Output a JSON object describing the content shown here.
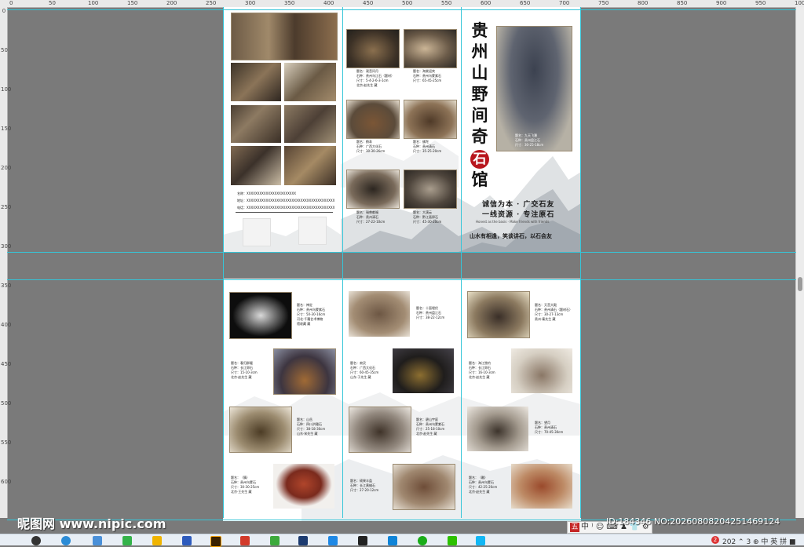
{
  "rulers": {
    "top_ticks": [
      "0",
      "50",
      "100",
      "150",
      "200",
      "250",
      "300",
      "350",
      "400",
      "450",
      "500",
      "550",
      "600",
      "650",
      "700",
      "750",
      "800",
      "850",
      "900",
      "950",
      "1000"
    ],
    "left_ticks": [
      "0",
      "50",
      "100",
      "150",
      "200",
      "250",
      "300",
      "350",
      "400",
      "450",
      "500",
      "550",
      "600"
    ]
  },
  "brochure": {
    "title_chars": [
      "贵",
      "州",
      "山",
      "野",
      "间",
      "奇"
    ],
    "title_red_chars": [
      "石",
      "馆"
    ],
    "slogan_lines": [
      "诚信为本 · 广交石友",
      "一线资源 · 专注原石"
    ],
    "slogan_en": "Honest as the basis · Make friends with friends",
    "slogan_bottom": "山水有相逢，笑谈讲石，以石会友",
    "cover_caption": [
      "题名：九天飞瀑",
      "石种：贵州盘江石",
      "尺寸：30-25-18cm"
    ],
    "contact": [
      {
        "label": "名称：",
        "value": "XXXXXXXXXXXXXXXXXXXXXXX"
      },
      {
        "label": "地址：",
        "value": "XXXXXXXXXXXXXXXXXXXXXXXXXXXXXXXXXXXXXXXXX"
      },
      {
        "label": "电话：",
        "value": "XXXXXXXXXXXXXXXXXXXXXXXXXXXXXXXXXXXXXXXXX"
      }
    ],
    "page1_middle_captions": [
      [
        "题名：观音问月",
        "石种：贵州乌江石（题材）",
        "尺寸：5-4-2-6-3-1cm",
        "北京·赵先生 藏"
      ],
      [
        "题名：海棠迎宾",
        "石种：贵州乌蒙紫石",
        "尺寸：65-45-25cm"
      ],
      [
        "题名：鹤寿",
        "石种：广西大化石",
        "尺寸：30-30-26cm"
      ],
      [
        "题名：佛陀",
        "石种：贵州清石",
        "尺寸：35-25-20cm"
      ],
      [
        "题名：瑞兽献福",
        "石种：贵州清石",
        "尺寸：27-22-10cm"
      ],
      [
        "题名：大漠云",
        "石种：黔江画卵石",
        "尺寸：45-30-20cm"
      ]
    ],
    "page2_captions": [
      [
        "题名：禅定",
        "石种：贵州乌蒙紫石",
        "尺寸：50-30-16cm",
        "河北·千羅艺术博物",
        "馆收藏 藏"
      ],
      [
        "题名：十面埋伏",
        "石种：贵州盘江石",
        "尺寸：38-22-12cm"
      ],
      [
        "题名：天音大殿",
        "石种：贵州清石（题材石）",
        "尺寸：30-27-13cm",
        "贵州·秦先生 藏"
      ],
      [
        "题名：春归群暖",
        "石种：长江卵石",
        "尺寸：15-10-3cm",
        "北京·赵先生 藏"
      ],
      [
        "题名：寂灵",
        "石种：广西大化石",
        "尺寸：60-45-35cm",
        "山东·于先生 藏"
      ],
      [
        "题名：海江独钓",
        "石种：长江卵石",
        "尺寸：16-10-3cm",
        "北京·赵先生 藏"
      ],
      [
        "题名：山岳",
        "石种：四川洪雅石",
        "尺寸：38-18-30cm",
        "山东·宋先生 藏"
      ],
      [
        "题名：碧山宇庭",
        "石种：贵州乌蒙紫石",
        "尺寸：25-18-10cm",
        "北京·赵先生 藏"
      ],
      [
        "题名：望月",
        "石种：贵州清石",
        "尺寸：70-45-30cm"
      ],
      [
        "题名：（腈）",
        "石种：贵州乌蒙石",
        "尺寸：30-30-25cm",
        "北京·王先生 藏"
      ],
      [
        "题名：硕果丰盈",
        "石种：长江黄蜡石",
        "尺寸：27-20-12cm"
      ],
      [
        "题名：（雕）",
        "石种：贵州乌蒙石",
        "尺寸：42-25-20cm",
        "北京·赵先生 藏"
      ]
    ]
  },
  "overlay": {
    "watermark": "昵图网 www.nipic.com",
    "image_id": "ID:184346 NO:20260808204251469124",
    "ime_text": "中 ⁾ ☺ ⌨ ♟ 👕 ⚙"
  },
  "taskbar": {
    "tray_text": "202 ⌃ 3 ⊕ 中 英 拼 ■"
  }
}
